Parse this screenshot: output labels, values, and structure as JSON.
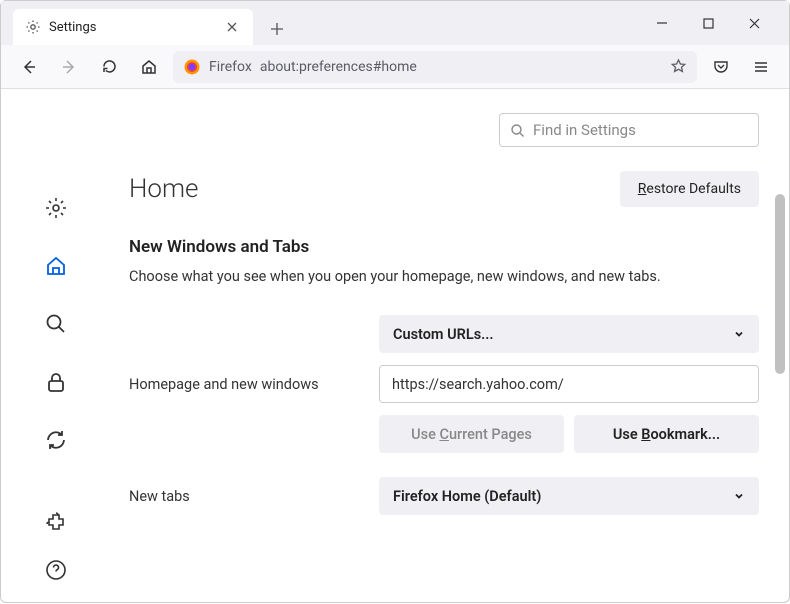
{
  "tab": {
    "title": "Settings"
  },
  "toolbar": {
    "addr_label": "Firefox",
    "addr_url": "about:preferences#home"
  },
  "search": {
    "placeholder": "Find in Settings"
  },
  "page": {
    "title": "Home",
    "restore_btn": "Restore Defaults"
  },
  "section": {
    "title": "New Windows and Tabs",
    "desc": "Choose what you see when you open your homepage, new windows, and new tabs."
  },
  "homepage": {
    "label": "Homepage and new windows",
    "dropdown": "Custom URLs...",
    "url": "https://search.yahoo.com/",
    "use_current": "Use Current Pages",
    "use_bookmark": "Use Bookmark..."
  },
  "newtabs": {
    "label": "New tabs",
    "dropdown": "Firefox Home (Default)"
  }
}
